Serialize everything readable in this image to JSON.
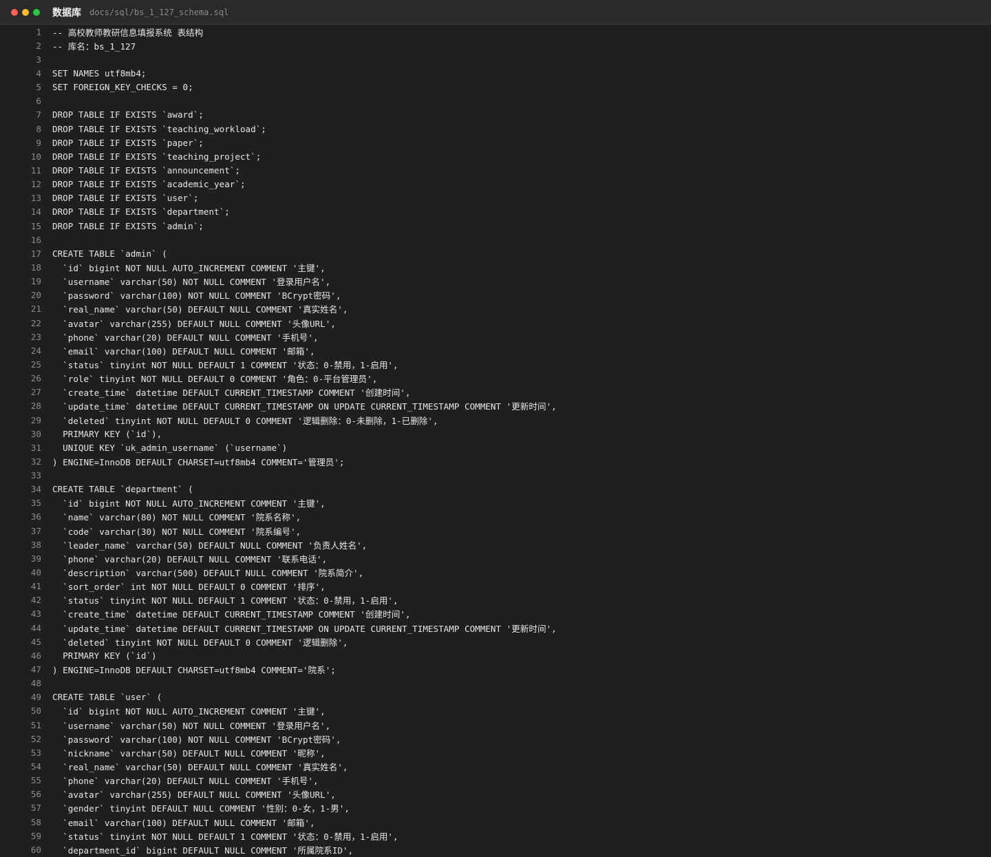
{
  "window": {
    "title": "数据库",
    "path": "docs/sql/bs_1_127_schema.sql",
    "traffic_lights": {
      "close_color": "#ff5f57",
      "minimize_color": "#febc2e",
      "zoom_color": "#28c840"
    }
  },
  "editor": {
    "lines": [
      "-- 高校教师教研信息填报系统 表结构",
      "-- 库名：bs_1_127",
      "",
      "SET NAMES utf8mb4;",
      "SET FOREIGN_KEY_CHECKS = 0;",
      "",
      "DROP TABLE IF EXISTS `award`;",
      "DROP TABLE IF EXISTS `teaching_workload`;",
      "DROP TABLE IF EXISTS `paper`;",
      "DROP TABLE IF EXISTS `teaching_project`;",
      "DROP TABLE IF EXISTS `announcement`;",
      "DROP TABLE IF EXISTS `academic_year`;",
      "DROP TABLE IF EXISTS `user`;",
      "DROP TABLE IF EXISTS `department`;",
      "DROP TABLE IF EXISTS `admin`;",
      "",
      "CREATE TABLE `admin` (",
      "  `id` bigint NOT NULL AUTO_INCREMENT COMMENT '主键',",
      "  `username` varchar(50) NOT NULL COMMENT '登录用户名',",
      "  `password` varchar(100) NOT NULL COMMENT 'BCrypt密码',",
      "  `real_name` varchar(50) DEFAULT NULL COMMENT '真实姓名',",
      "  `avatar` varchar(255) DEFAULT NULL COMMENT '头像URL',",
      "  `phone` varchar(20) DEFAULT NULL COMMENT '手机号',",
      "  `email` varchar(100) DEFAULT NULL COMMENT '邮箱',",
      "  `status` tinyint NOT NULL DEFAULT 1 COMMENT '状态：0-禁用，1-启用',",
      "  `role` tinyint NOT NULL DEFAULT 0 COMMENT '角色：0-平台管理员',",
      "  `create_time` datetime DEFAULT CURRENT_TIMESTAMP COMMENT '创建时间',",
      "  `update_time` datetime DEFAULT CURRENT_TIMESTAMP ON UPDATE CURRENT_TIMESTAMP COMMENT '更新时间',",
      "  `deleted` tinyint NOT NULL DEFAULT 0 COMMENT '逻辑删除：0-未删除，1-已删除',",
      "  PRIMARY KEY (`id`),",
      "  UNIQUE KEY `uk_admin_username` (`username`)",
      ") ENGINE=InnoDB DEFAULT CHARSET=utf8mb4 COMMENT='管理员';",
      "",
      "CREATE TABLE `department` (",
      "  `id` bigint NOT NULL AUTO_INCREMENT COMMENT '主键',",
      "  `name` varchar(80) NOT NULL COMMENT '院系名称',",
      "  `code` varchar(30) NOT NULL COMMENT '院系编号',",
      "  `leader_name` varchar(50) DEFAULT NULL COMMENT '负责人姓名',",
      "  `phone` varchar(20) DEFAULT NULL COMMENT '联系电话',",
      "  `description` varchar(500) DEFAULT NULL COMMENT '院系简介',",
      "  `sort_order` int NOT NULL DEFAULT 0 COMMENT '排序',",
      "  `status` tinyint NOT NULL DEFAULT 1 COMMENT '状态：0-禁用，1-启用',",
      "  `create_time` datetime DEFAULT CURRENT_TIMESTAMP COMMENT '创建时间',",
      "  `update_time` datetime DEFAULT CURRENT_TIMESTAMP ON UPDATE CURRENT_TIMESTAMP COMMENT '更新时间',",
      "  `deleted` tinyint NOT NULL DEFAULT 0 COMMENT '逻辑删除',",
      "  PRIMARY KEY (`id`)",
      ") ENGINE=InnoDB DEFAULT CHARSET=utf8mb4 COMMENT='院系';",
      "",
      "CREATE TABLE `user` (",
      "  `id` bigint NOT NULL AUTO_INCREMENT COMMENT '主键',",
      "  `username` varchar(50) NOT NULL COMMENT '登录用户名',",
      "  `password` varchar(100) NOT NULL COMMENT 'BCrypt密码',",
      "  `nickname` varchar(50) DEFAULT NULL COMMENT '昵称',",
      "  `real_name` varchar(50) DEFAULT NULL COMMENT '真实姓名',",
      "  `phone` varchar(20) DEFAULT NULL COMMENT '手机号',",
      "  `avatar` varchar(255) DEFAULT NULL COMMENT '头像URL',",
      "  `gender` tinyint DEFAULT NULL COMMENT '性别：0-女，1-男',",
      "  `email` varchar(100) DEFAULT NULL COMMENT '邮箱',",
      "  `status` tinyint NOT NULL DEFAULT 1 COMMENT '状态：0-禁用，1-启用',",
      "  `department_id` bigint DEFAULT NULL COMMENT '所属院系ID',"
    ]
  }
}
